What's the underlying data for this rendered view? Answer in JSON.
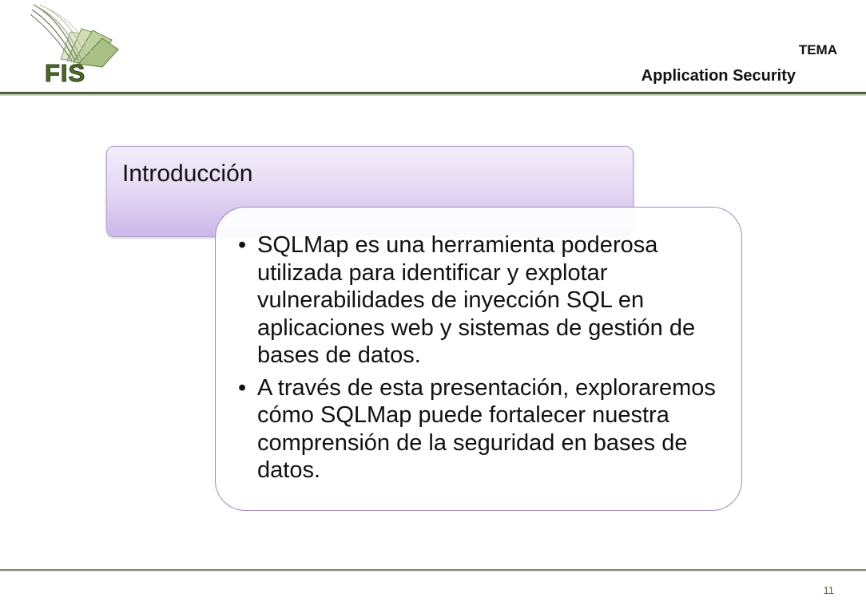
{
  "header": {
    "logo_text": "FIS",
    "topic_label": "TEMA",
    "topic_value": "Application Security"
  },
  "slide": {
    "title": "Introducción",
    "bullets": [
      {
        "marker": "•",
        "text": "SQLMap es una herramienta poderosa utilizada para identificar y explotar vulnerabilidades de inyección SQL en aplicaciones web y sistemas de gestión de bases de datos."
      },
      {
        "marker": "•",
        "text": "A través de esta presentación, exploraremos cómo SQLMap puede fortalecer nuestra comprensión de la seguridad en bases de datos."
      }
    ]
  },
  "footer": {
    "page_number": "11"
  },
  "colors": {
    "accent_green": "#4e6a2a",
    "title_box_purple": "#cdb8ea",
    "content_border": "#9e8bbd"
  }
}
